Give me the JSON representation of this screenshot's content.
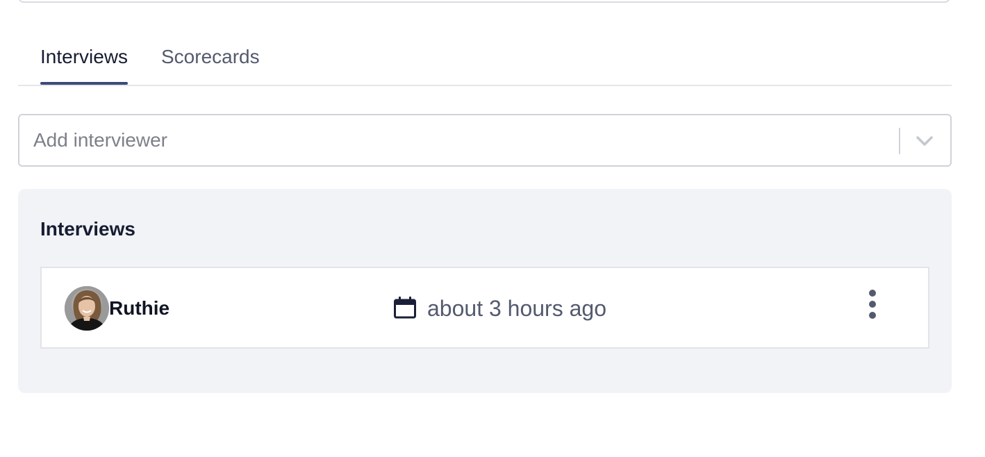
{
  "tabs": [
    {
      "label": "Interviews",
      "active": true
    },
    {
      "label": "Scorecards",
      "active": false
    }
  ],
  "interviewer_select": {
    "placeholder": "Add interviewer",
    "icon": "chevron-down-icon"
  },
  "interviews_panel": {
    "title": "Interviews",
    "items": [
      {
        "name": "Ruthie",
        "time": "about 3 hours ago",
        "date_icon": "calendar-icon",
        "menu_icon": "more-vertical-icon"
      }
    ]
  },
  "colors": {
    "accent": "#3d4a78",
    "text_primary": "#171c33",
    "text_secondary": "#545a6e",
    "panel_bg": "#f2f3f6"
  }
}
